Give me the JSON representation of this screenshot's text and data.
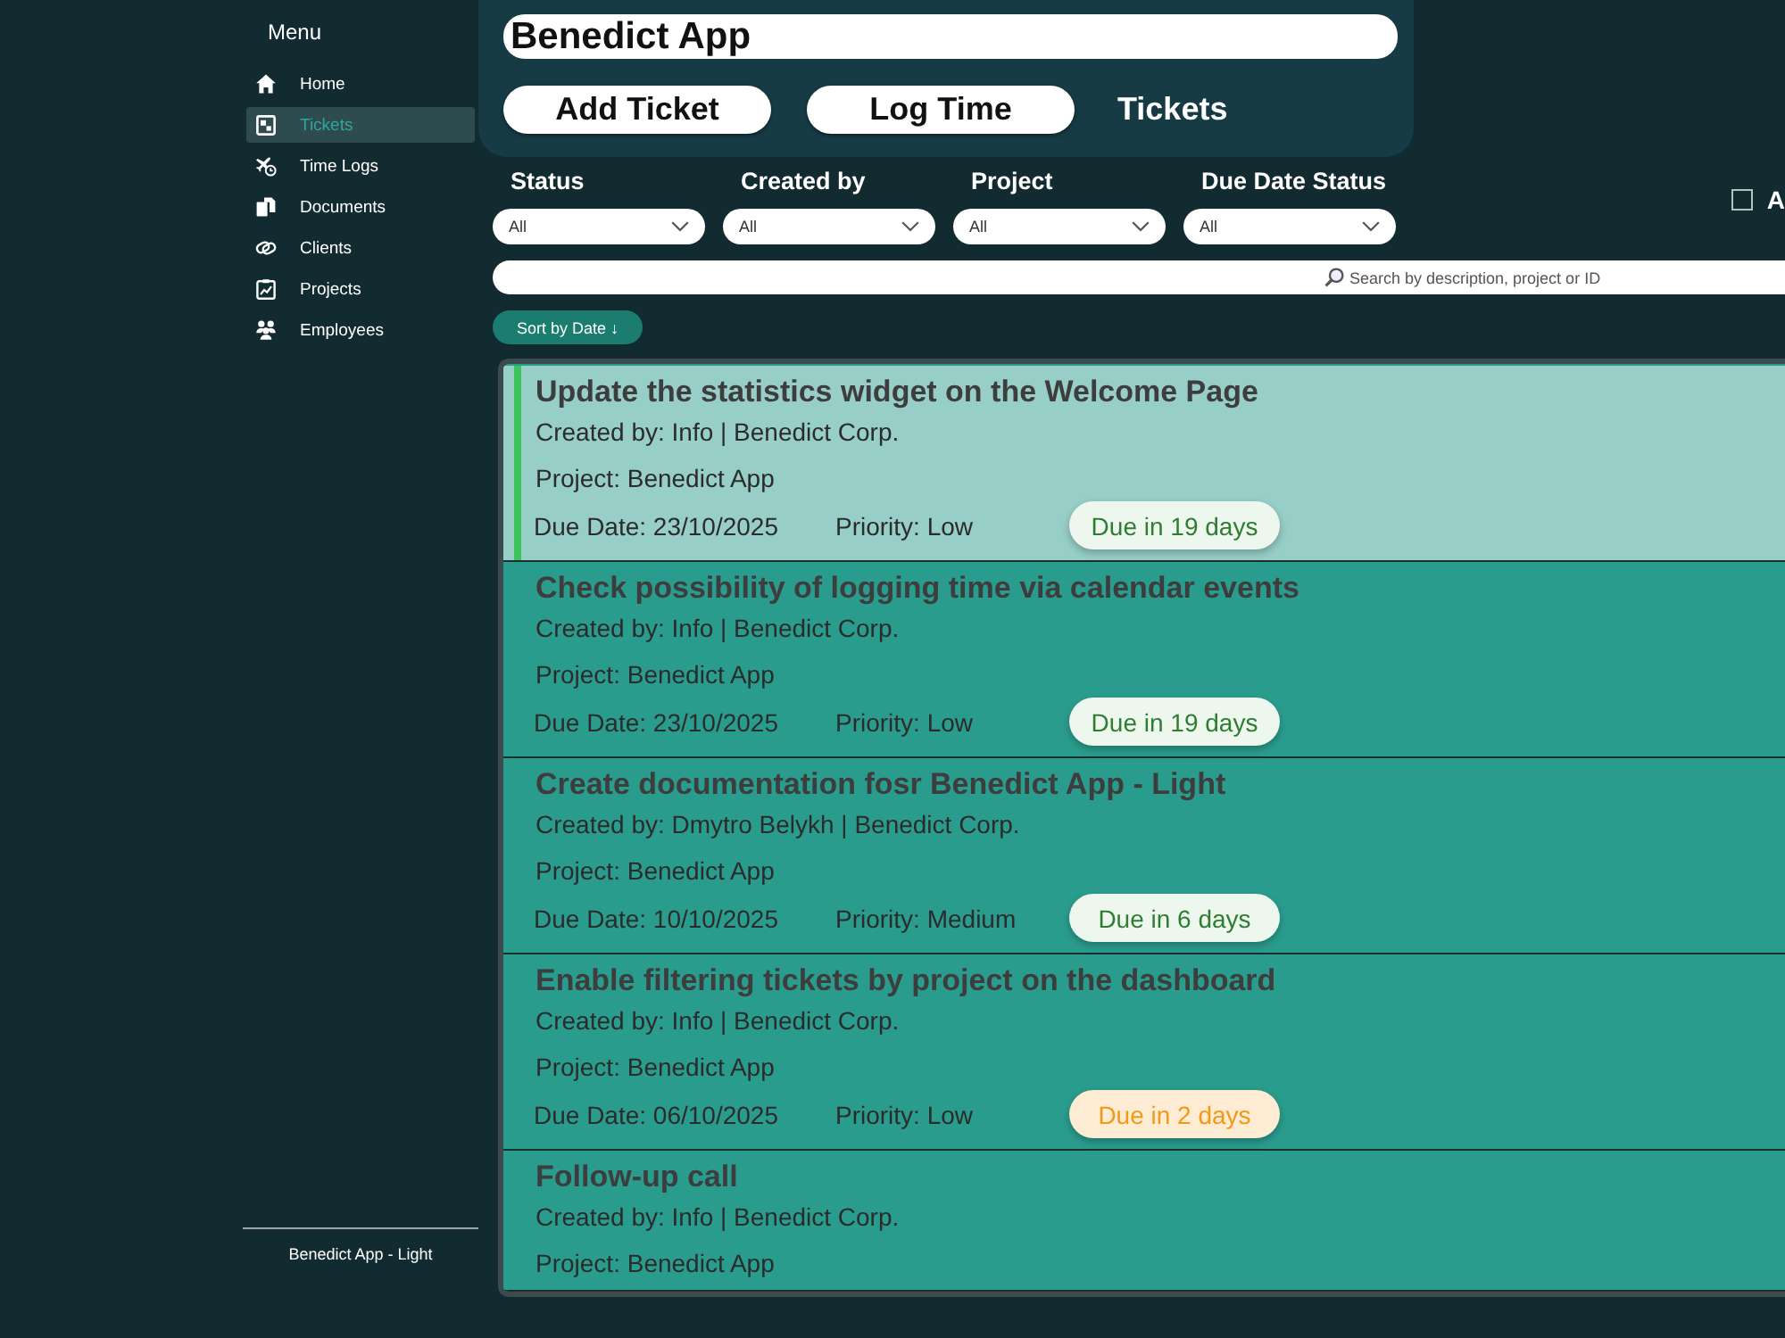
{
  "sidebar": {
    "title": "Menu",
    "items": [
      {
        "label": "Home",
        "selected": false
      },
      {
        "label": "Tickets",
        "selected": true
      },
      {
        "label": "Time Logs",
        "selected": false
      },
      {
        "label": "Documents",
        "selected": false
      },
      {
        "label": "Clients",
        "selected": false
      },
      {
        "label": "Projects",
        "selected": false
      },
      {
        "label": "Employees",
        "selected": false
      }
    ],
    "footer": "Benedict App - Light"
  },
  "header": {
    "app_title": "Benedict App",
    "buttons": [
      "Add Ticket",
      "Log Time"
    ],
    "page_title": "Tickets"
  },
  "filters": [
    {
      "label": "Status",
      "value": "All"
    },
    {
      "label": "Created by",
      "value": "All"
    },
    {
      "label": "Project",
      "value": "All"
    },
    {
      "label": "Due Date Status",
      "value": "All"
    }
  ],
  "checkbox": {
    "label": "A",
    "checked": false
  },
  "search": {
    "placeholder": "Search by description, project or ID"
  },
  "sort_button": "Sort by Date ↓",
  "tickets": [
    {
      "title": "Update the statistics widget on the Welcome Page",
      "created_by": "Created by: Info | Benedict Corp.",
      "project": "Project: Benedict App",
      "due_date": "Due Date: 23/10/2025",
      "priority": "Priority: Low",
      "due_badge": {
        "text": "Due in 19 days",
        "kind": "ok"
      },
      "selected": true
    },
    {
      "title": "Check possibility of logging time via calendar events",
      "created_by": "Created by: Info | Benedict Corp.",
      "project": "Project: Benedict App",
      "due_date": "Due Date: 23/10/2025",
      "priority": "Priority: Low",
      "due_badge": {
        "text": "Due in 19 days",
        "kind": "ok"
      },
      "selected": false
    },
    {
      "title": "Create documentation fosr Benedict App - Light",
      "created_by": "Created by: Dmytro Belykh | Benedict Corp.",
      "project": "Project: Benedict App",
      "due_date": "Due Date: 10/10/2025",
      "priority": "Priority: Medium",
      "due_badge": {
        "text": "Due in 6 days",
        "kind": "ok"
      },
      "selected": false
    },
    {
      "title": "Enable filtering tickets by project on the dashboard",
      "created_by": "Created by: Info | Benedict Corp.",
      "project": "Project: Benedict App",
      "due_date": "Due Date: 06/10/2025",
      "priority": "Priority: Low",
      "due_badge": {
        "text": "Due in 2 days",
        "kind": "warning"
      },
      "selected": false
    },
    {
      "title": "Follow-up call",
      "created_by": "Created by: Info | Benedict Corp.",
      "project": "Project: Benedict App",
      "selected": false
    }
  ]
}
